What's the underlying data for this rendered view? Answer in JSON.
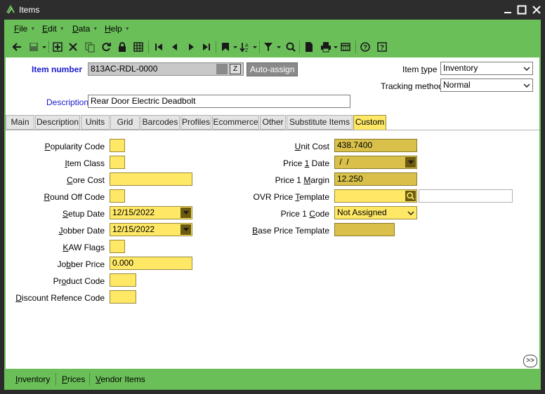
{
  "window": {
    "title": "Items"
  },
  "menu": [
    {
      "key": "file",
      "label": "File",
      "u": "F",
      "rest": "ile"
    },
    {
      "key": "edit",
      "label": "Edit",
      "u": "E",
      "rest": "dit"
    },
    {
      "key": "data",
      "label": "Data",
      "u": "D",
      "rest": "ata"
    },
    {
      "key": "help",
      "label": "Help",
      "u": "H",
      "rest": "elp"
    }
  ],
  "header": {
    "item_number_label": "Item number",
    "item_number_value": "813AC-RDL-0000",
    "auto_assign_label": "Auto-assign",
    "description_label": "Description",
    "description_value": "Rear Door Electric Deadbolt",
    "item_type_label": "Item type",
    "item_type_value": "Inventory",
    "tracking_method_label": "Tracking method",
    "tracking_method_value": "Normal"
  },
  "tabs": [
    "Main",
    "Description",
    "Units",
    "Grid",
    "Barcodes",
    "Profiles",
    "Ecommerce",
    "Other",
    "Substitute Items",
    "Custom"
  ],
  "active_tab": "Custom",
  "custom_left": [
    {
      "key": "popularity_code",
      "label_pre": "",
      "label_u": "P",
      "label_post": "opularity Code",
      "value": ""
    },
    {
      "key": "item_class",
      "label_pre": "",
      "label_u": "I",
      "label_post": "tem Class",
      "value": ""
    },
    {
      "key": "core_cost",
      "label_pre": "",
      "label_u": "C",
      "label_post": "ore Cost",
      "value": ""
    },
    {
      "key": "round_off_code",
      "label_pre": "",
      "label_u": "R",
      "label_post": "ound Off Code",
      "value": ""
    },
    {
      "key": "setup_date",
      "label_pre": "",
      "label_u": "S",
      "label_post": "etup Date",
      "value": "12/15/2022"
    },
    {
      "key": "jobber_date",
      "label_pre": "",
      "label_u": "J",
      "label_post": "obber Date",
      "value": "12/15/2022"
    },
    {
      "key": "kaw_flags",
      "label_pre": "",
      "label_u": "K",
      "label_post": "AW Flags",
      "value": ""
    },
    {
      "key": "jobber_price",
      "label_pre": "Jo",
      "label_u": "b",
      "label_post": "ber Price",
      "value": "0.000"
    },
    {
      "key": "product_code",
      "label_pre": "Pr",
      "label_u": "o",
      "label_post": "duct Code",
      "value": ""
    },
    {
      "key": "discount_refence_code",
      "label_pre": "",
      "label_u": "D",
      "label_post": "iscount Refence Code",
      "value": ""
    }
  ],
  "custom_right": [
    {
      "key": "unit_cost",
      "label_pre": "",
      "label_u": "U",
      "label_post": "nit Cost",
      "value": "438.7400"
    },
    {
      "key": "price_1_date",
      "label_pre": "Price ",
      "label_u": "1",
      "label_post": " Date",
      "value": " /  /"
    },
    {
      "key": "price_1_margin",
      "label_pre": "Price 1 ",
      "label_u": "M",
      "label_post": "argin",
      "value": "12.250"
    },
    {
      "key": "ovr_price_template",
      "label_pre": "OVR Price ",
      "label_u": "T",
      "label_post": "emplate",
      "value": "",
      "extra_value": ""
    },
    {
      "key": "price_1_code",
      "label_pre": "Price 1 ",
      "label_u": "C",
      "label_post": "ode",
      "value": "Not Assigned"
    },
    {
      "key": "base_price_template",
      "label_pre": "",
      "label_u": "B",
      "label_post": "ase Price Template",
      "value": ""
    }
  ],
  "bottom_links": [
    {
      "key": "inventory",
      "u": "I",
      "rest": "nventory"
    },
    {
      "key": "prices",
      "u": "P",
      "rest": "rices"
    },
    {
      "key": "vendor_items",
      "u": "V",
      "rest": "endor Items"
    }
  ],
  "expand_label": ">>",
  "colors": {
    "frame_green": "#6bbf59",
    "field_yellow": "#ffe866",
    "field_dark_yellow": "#d8c04a",
    "title_bar": "#2d2d2d",
    "label_blue": "#1a1acf"
  }
}
